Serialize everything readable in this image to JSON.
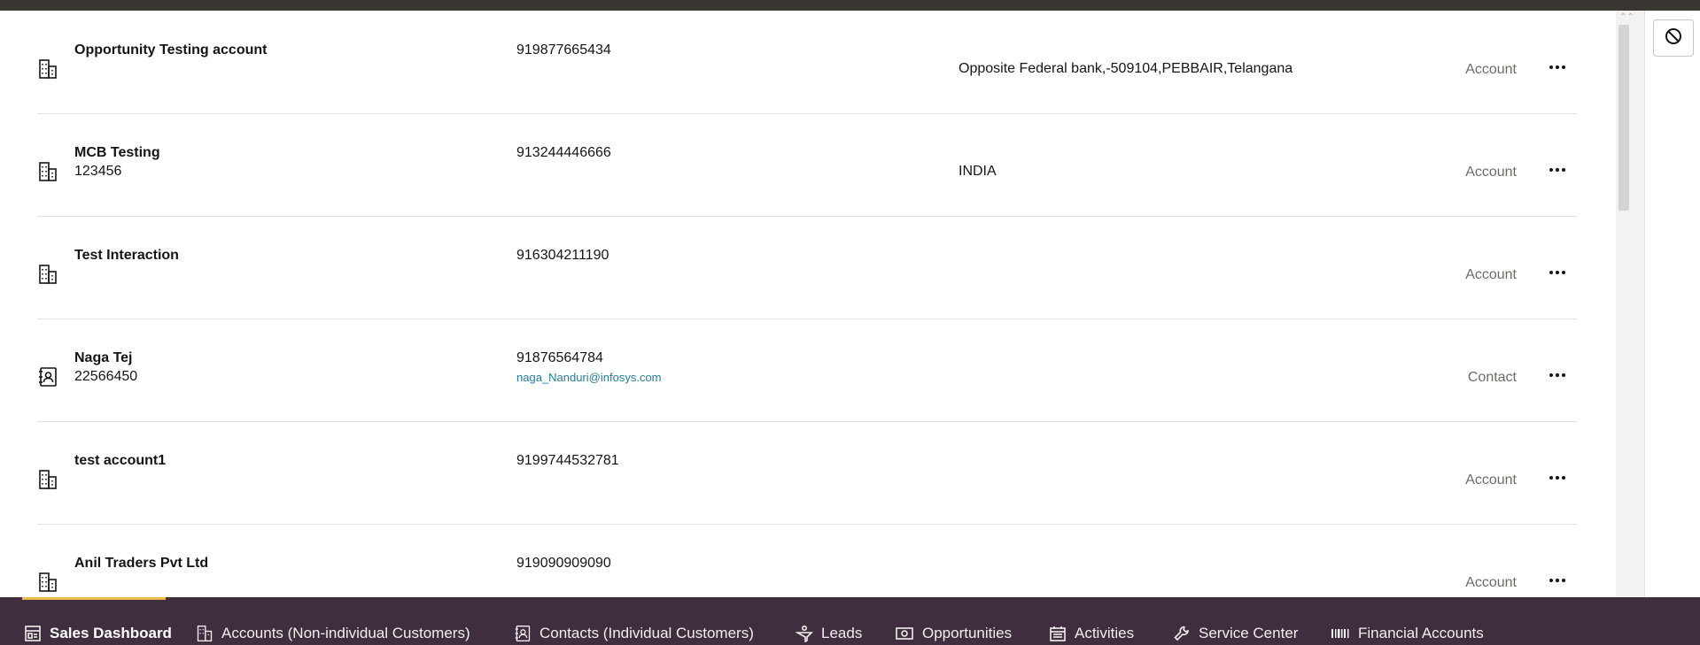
{
  "records": [
    {
      "name": "Opportunity Testing account",
      "sub": "",
      "phone": "919877665434",
      "email": "",
      "address": "Opposite Federal bank,-509104,PEBBAIR,Telangana",
      "type": "Account",
      "icon": "building-icon"
    },
    {
      "name": "MCB Testing",
      "sub": "123456",
      "phone": "913244446666",
      "email": "",
      "address": "INDIA",
      "type": "Account",
      "icon": "building-icon"
    },
    {
      "name": "Test Interaction",
      "sub": "",
      "phone": "916304211190",
      "email": "",
      "address": "",
      "type": "Account",
      "icon": "building-icon"
    },
    {
      "name": "Naga Tej",
      "sub": "22566450",
      "phone": "91876564784",
      "email": "naga_Nanduri@infosys.com",
      "address": "",
      "type": "Contact",
      "icon": "contact-card-icon"
    },
    {
      "name": "test account1",
      "sub": "",
      "phone": "9199744532781",
      "email": "",
      "address": "",
      "type": "Account",
      "icon": "building-icon"
    },
    {
      "name": "Anil Traders Pvt Ltd",
      "sub": "",
      "phone": "919090909090",
      "email": "",
      "address": "",
      "type": "Account",
      "icon": "building-icon"
    }
  ],
  "nav": {
    "sales_dashboard": "Sales Dashboard",
    "accounts": "Accounts (Non-individual Customers)",
    "contacts": "Contacts (Individual Customers)",
    "leads": "Leads",
    "opportunities": "Opportunities",
    "activities": "Activities",
    "service_center": "Service Center",
    "financial_accounts": "Financial Accounts"
  },
  "colors": {
    "nav_bg": "#3f2e3d",
    "active_accent": "#e8b94b",
    "link": "#227e9e",
    "top_bar": "#3a3631"
  }
}
